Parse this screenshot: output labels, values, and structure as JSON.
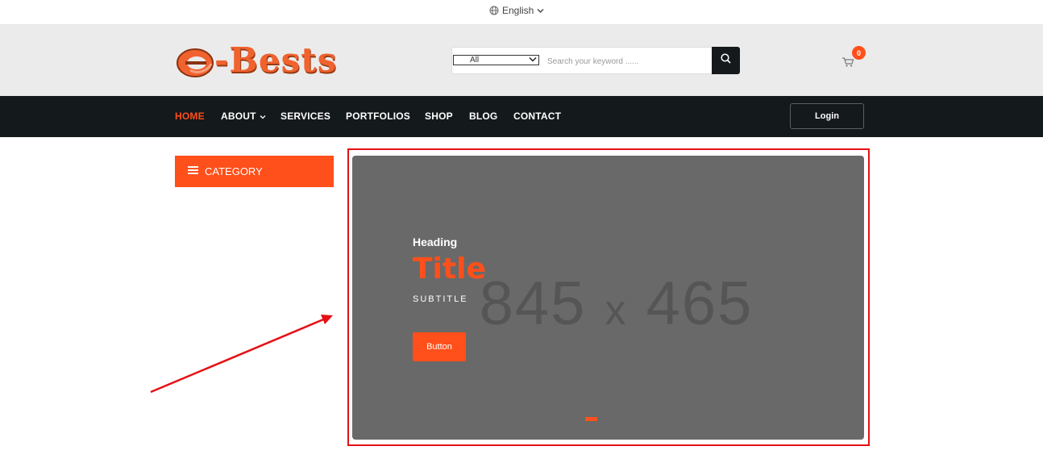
{
  "topbar": {
    "language": "English",
    "globe_icon": "globe-icon",
    "chevron_icon": "chevron-down-icon"
  },
  "header": {
    "logo_text": "-Bests",
    "search": {
      "category_value": "All",
      "placeholder": "Search your keyword ......"
    },
    "cart_count": "0"
  },
  "nav": {
    "items": [
      {
        "label": "HOME",
        "active": true
      },
      {
        "label": "ABOUT",
        "dropdown": true
      },
      {
        "label": "SERVICES"
      },
      {
        "label": "PORTFOLIOS"
      },
      {
        "label": "SHOP"
      },
      {
        "label": "BLOG"
      },
      {
        "label": "CONTACT"
      }
    ],
    "login_label": "Login"
  },
  "sidebar": {
    "category_label": "CATEGORY"
  },
  "slider": {
    "placeholder_width": "845",
    "placeholder_x": "x",
    "placeholder_height": "465",
    "heading": "Heading",
    "title": "Title",
    "subtitle": "SUBTITLE",
    "button_label": "Button"
  },
  "colors": {
    "accent": "#ff4f1a",
    "nav_bg": "#14191c",
    "header_bg": "#ebebeb",
    "slide_bg": "#696969",
    "highlight": "#e60f14"
  }
}
